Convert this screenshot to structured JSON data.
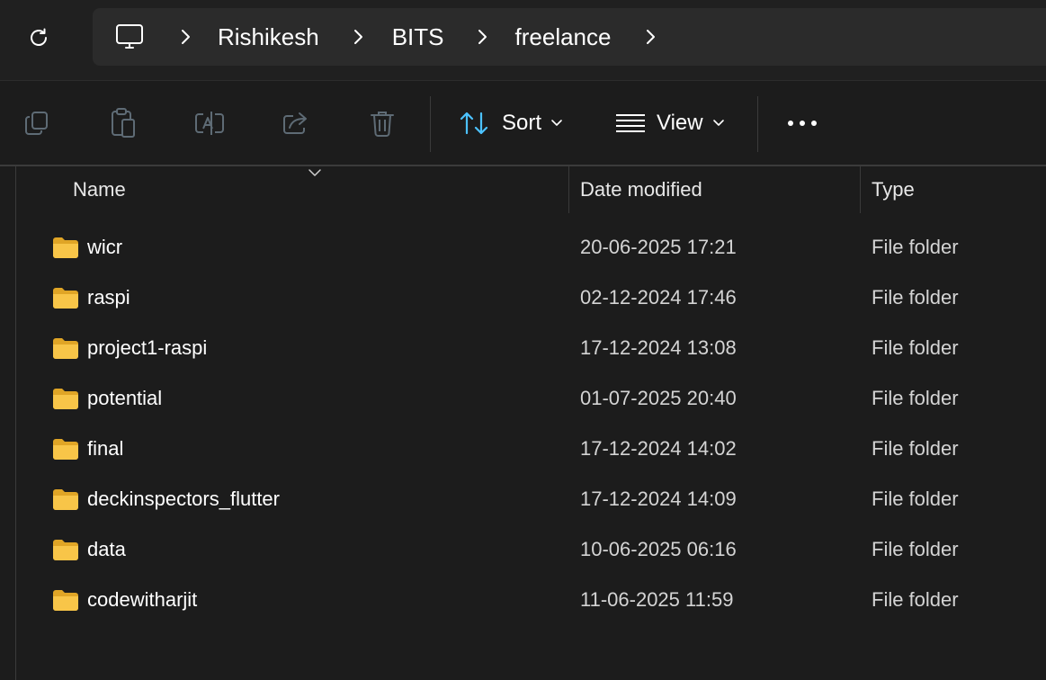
{
  "address": {
    "breadcrumbs": [
      "Rishikesh",
      "BITS",
      "freelance"
    ]
  },
  "toolbar": {
    "icons": [
      "copy-icon",
      "paste-icon",
      "rename-icon",
      "share-icon",
      "delete-icon"
    ],
    "sort_label": "Sort",
    "view_label": "View",
    "accent": "#4cc2ff"
  },
  "columns": {
    "name": "Name",
    "date": "Date modified",
    "type": "Type"
  },
  "files": [
    {
      "name": "wicr",
      "date": "20-06-2025 17:21",
      "type": "File folder"
    },
    {
      "name": "raspi",
      "date": "02-12-2024 17:46",
      "type": "File folder"
    },
    {
      "name": "project1-raspi",
      "date": "17-12-2024 13:08",
      "type": "File folder"
    },
    {
      "name": "potential",
      "date": "01-07-2025 20:40",
      "type": "File folder"
    },
    {
      "name": "final",
      "date": "17-12-2024 14:02",
      "type": "File folder"
    },
    {
      "name": "deckinspectors_flutter",
      "date": "17-12-2024 14:09",
      "type": "File folder"
    },
    {
      "name": "data",
      "date": "10-06-2025 06:16",
      "type": "File folder"
    },
    {
      "name": "codewitharjit",
      "date": "11-06-2025 11:59",
      "type": "File folder"
    }
  ],
  "colors": {
    "folder": "#f8c548",
    "background": "#1c1c1c"
  }
}
